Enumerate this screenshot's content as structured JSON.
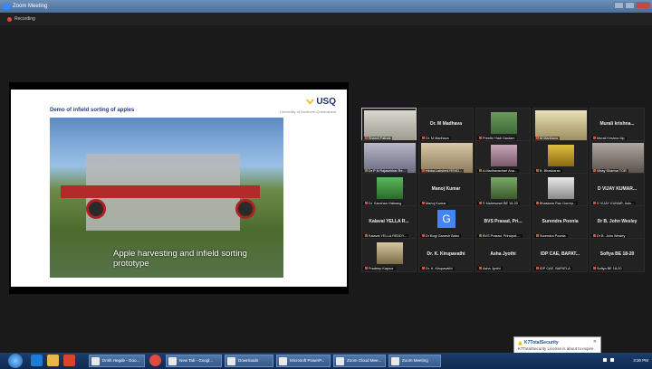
{
  "window": {
    "title": "Zoom Meeting"
  },
  "recording": {
    "label": "Recording"
  },
  "slide": {
    "title": "Demo of infield sorting of apples",
    "logo_text": "USQ",
    "tagline": "University of Southern Queensland",
    "caption": "Apple harvesting and infield sorting prototype"
  },
  "participants": [
    {
      "label": "Shamli Pathak",
      "center": ""
    },
    {
      "label": "Dr. M Madhava",
      "center": "Dr. M Madhava"
    },
    {
      "label": "Preethi Hadi Gautam",
      "center": ""
    },
    {
      "label": "M Madhava",
      "center": ""
    },
    {
      "label": "Murali Krishna Mp",
      "center": "Murali krishna..."
    },
    {
      "label": "Dr P N Rajasekhar Re...",
      "center": ""
    },
    {
      "label": "Hema Lakshmi RSVD...",
      "center": ""
    },
    {
      "label": "A Madhavachari Ana...",
      "center": ""
    },
    {
      "label": "B. Bhaskaran",
      "center": ""
    },
    {
      "label": "Vinay Sharma TGR",
      "center": ""
    },
    {
      "label": "Dr. Kanchan Hatnang",
      "center": ""
    },
    {
      "label": "Manoj Kumar",
      "center": "Manoj Kumar"
    },
    {
      "label": "S Maheswari BE 18-20",
      "center": ""
    },
    {
      "label": "Bhaskara Rao Gorrep...",
      "center": ""
    },
    {
      "label": "D VIJAY KUMAR, Asis...",
      "center": "D VIJAY KUMAR..."
    },
    {
      "label": "Kalavai YELLA REDDY...",
      "center": "Kalavai YELLA R..."
    },
    {
      "label": "Dr Bogi Ganesh Babu",
      "center": "G"
    },
    {
      "label": "BVS Prasad, Principal ...",
      "center": "BVS Prasad, Pri..."
    },
    {
      "label": "Surendra Poonia",
      "center": "Surendra Poonia"
    },
    {
      "label": "Dr B. John Wesley",
      "center": "Dr B. John Wesley"
    },
    {
      "label": "Pradeep Kapoor",
      "center": ""
    },
    {
      "label": "Dr. K. Kirupavathi",
      "center": "Dr. K. Kirupavathi"
    },
    {
      "label": "Asha Jyothi",
      "center": "Asha Jyothi"
    },
    {
      "label": "IDP CAE, BAPATLA",
      "center": "IDP CAE, BAPAT..."
    },
    {
      "label": "Sofiya BE 18-20",
      "center": "Sofiya BE 18-20"
    }
  ],
  "taskbar": {
    "tasks": [
      "Drish Hegde - Goo...",
      "New Tab - Googl...",
      "Downloads",
      "Microsoft PowerP...",
      "Zoom Cloud Mee...",
      "Zoom Meeting"
    ],
    "clock": "3:30 PM"
  },
  "toast": {
    "title": "K7TotalSecurity",
    "body": "K7TotalSecurity License is about to expire. Click here to resolve."
  },
  "colors": {
    "accent": "#2d8cff",
    "active_speaker": "#c8e000",
    "mic_muted": "#e04a3f"
  }
}
